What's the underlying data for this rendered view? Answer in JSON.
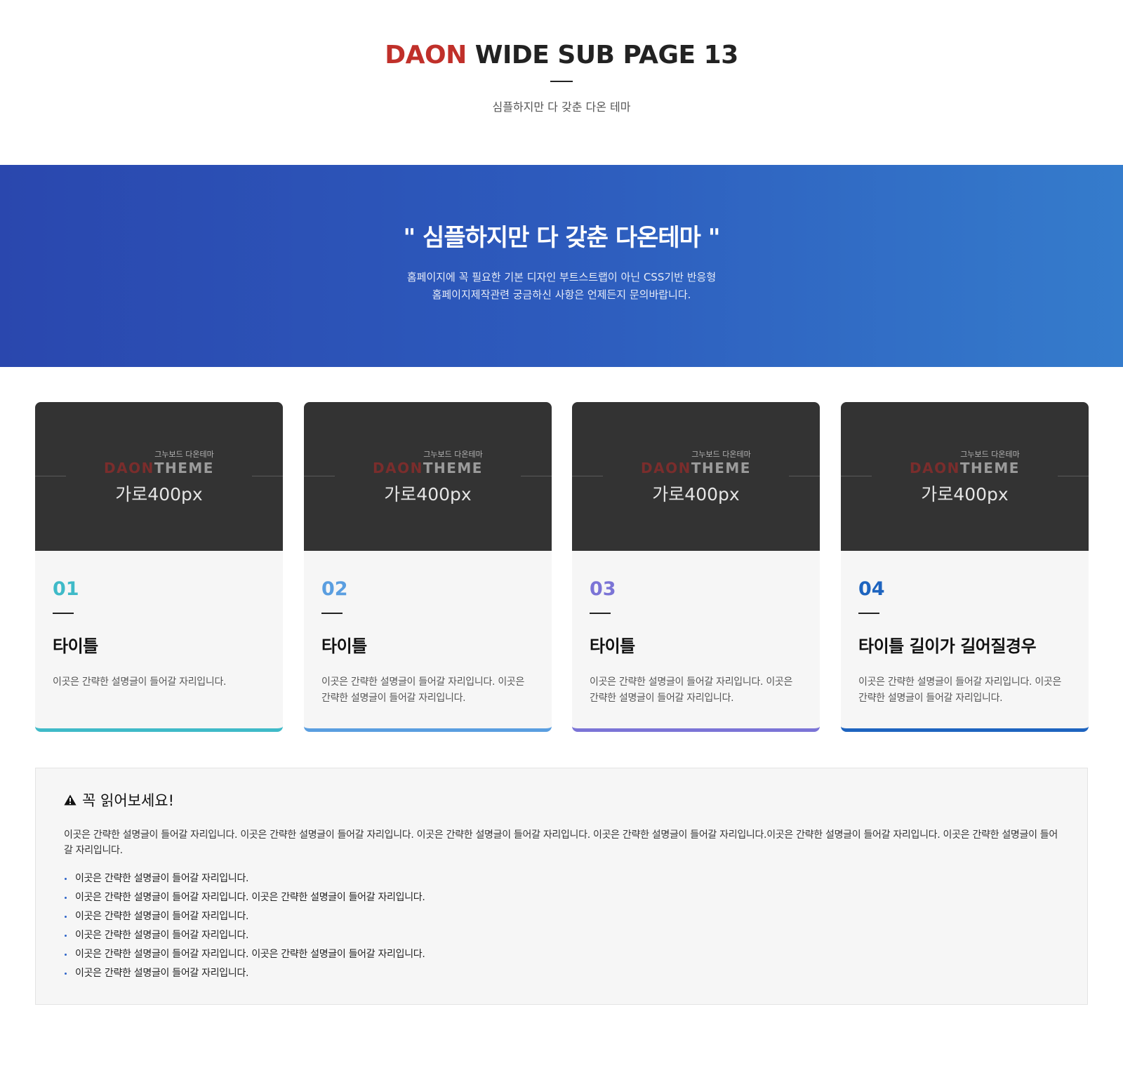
{
  "header": {
    "title_accent": "DAON",
    "title_rest": "WIDE SUB PAGE 13",
    "subtitle": "심플하지만 다 갖춘 다온 테마"
  },
  "banner": {
    "quote": "\" 심플하지만 다 갖춘 다온테마 \"",
    "line1": "홈페이지에 꼭 필요한 기본 디자인 부트스트랩이 아닌 CSS기반 반응형",
    "line2": "홈페이지제작관련 궁금하신 사항은 언제든지 문의바랍니다."
  },
  "thumb": {
    "small": "그누보드 다온테마",
    "brand_a": "DAON",
    "brand_b": "THEME",
    "size": "가로400px"
  },
  "cards": [
    {
      "num": "01",
      "title": "타이틀",
      "desc": "이곳은 간략한 설명글이 들어갈 자리입니다.",
      "color": "#3fbac8"
    },
    {
      "num": "02",
      "title": "타이틀",
      "desc": "이곳은 간략한 설명글이 들어갈 자리입니다. 이곳은 간략한 설명글이 들어갈 자리입니다.",
      "color": "#5a9ee0"
    },
    {
      "num": "03",
      "title": "타이틀",
      "desc": "이곳은 간략한 설명글이 들어갈 자리입니다. 이곳은 간략한 설명글이 들어갈 자리입니다.",
      "color": "#7b74d6"
    },
    {
      "num": "04",
      "title": "타이틀 길이가 길어질경우",
      "desc": "이곳은 간략한 설명글이 들어갈 자리입니다. 이곳은 간략한 설명글이 들어갈 자리입니다.",
      "color": "#1e64bf"
    }
  ],
  "notice": {
    "icon": "warning-icon",
    "title": "꼭 읽어보세요!",
    "paragraph": "이곳은 간략한 설명글이 들어갈 자리입니다. 이곳은 간략한 설명글이 들어갈 자리입니다. 이곳은 간략한 설명글이 들어갈 자리입니다. 이곳은 간략한 설명글이 들어갈 자리입니다.이곳은 간략한 설명글이 들어갈 자리입니다. 이곳은 간략한 설명글이 들어갈 자리입니다.",
    "items": [
      "이곳은 간략한 설명글이 들어갈 자리입니다.",
      "이곳은 간략한 설명글이 들어갈 자리입니다. 이곳은 간략한 설명글이 들어갈 자리입니다.",
      "이곳은 간략한 설명글이 들어갈 자리입니다.",
      "이곳은 간략한 설명글이 들어갈 자리입니다.",
      "이곳은 간략한 설명글이 들어갈 자리입니다. 이곳은 간략한 설명글이 들어갈 자리입니다.",
      "이곳은 간략한 설명글이 들어갈 자리입니다."
    ]
  }
}
